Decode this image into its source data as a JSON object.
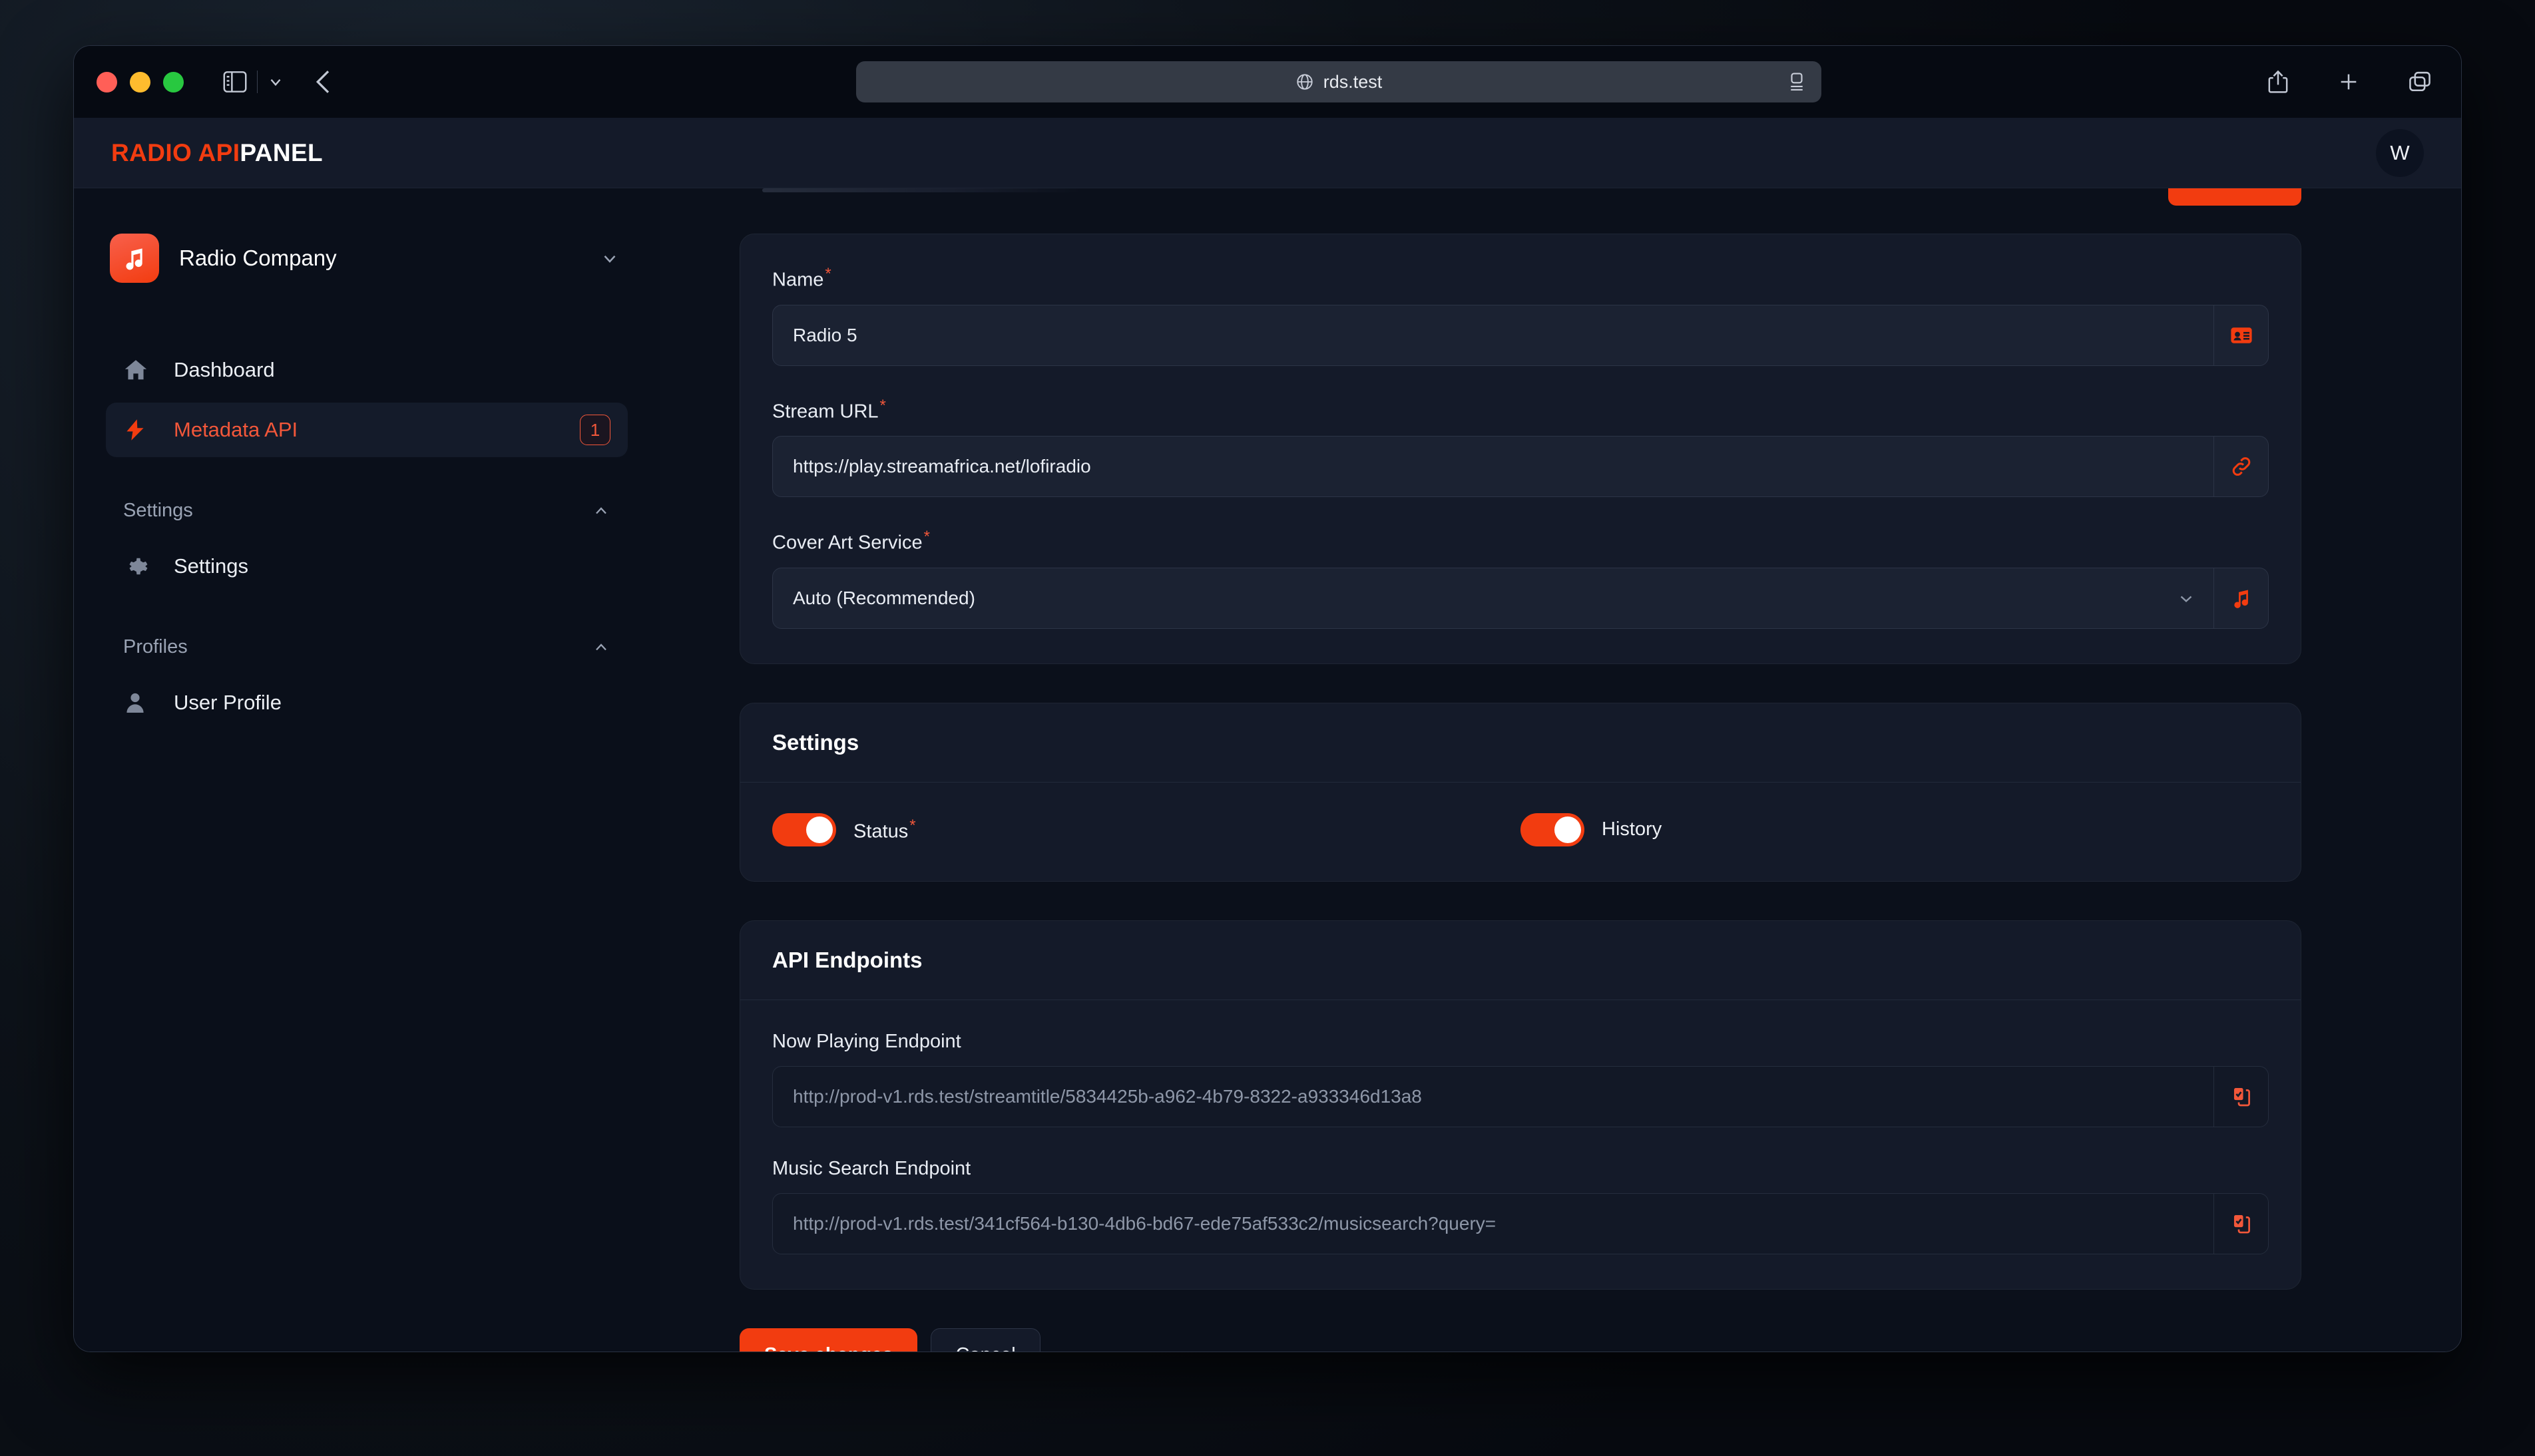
{
  "browser": {
    "url": "rds.test",
    "globe_icon": "globe-icon",
    "reader_icon": "reader-view-icon",
    "sidebar_icon": "sidebar-toggle-icon",
    "chevron_icon": "chevron-down-icon",
    "back_icon": "back-arrow-icon",
    "share_icon": "share-icon",
    "new_tab_icon": "plus-icon",
    "tabs_icon": "tab-overview-icon"
  },
  "app_header": {
    "brand_accent": "RADIO API",
    "brand_rest": "PANEL",
    "avatar_initial": "W"
  },
  "sidebar": {
    "org": {
      "name": "Radio Company",
      "logo_icon": "music-note-icon",
      "chevron_icon": "chevron-down-icon"
    },
    "items": [
      {
        "label": "Dashboard",
        "icon": "home-icon",
        "active": false,
        "badge": ""
      },
      {
        "label": "Metadata API",
        "icon": "lightning-bolt-icon",
        "active": true,
        "badge": "1"
      }
    ],
    "sections": [
      {
        "title": "Settings",
        "chevron_icon": "chevron-up-icon",
        "items": [
          {
            "label": "Settings",
            "icon": "gear-icon"
          }
        ]
      },
      {
        "title": "Profiles",
        "chevron_icon": "chevron-up-icon",
        "items": [
          {
            "label": "User Profile",
            "icon": "user-icon"
          }
        ]
      }
    ]
  },
  "main": {
    "details_card": {
      "fields": [
        {
          "label": "Name",
          "required": true,
          "value": "Radio 5",
          "addon_icon": "contact-card-icon",
          "type": "text"
        },
        {
          "label": "Stream URL",
          "required": true,
          "value": "https://play.streamafrica.net/lofiradio",
          "addon_icon": "link-icon",
          "type": "text"
        },
        {
          "label": "Cover Art Service",
          "required": true,
          "value": "Auto (Recommended)",
          "addon_icon": "music-note-icon",
          "type": "select",
          "chevron_icon": "chevron-down-icon"
        }
      ]
    },
    "settings_card": {
      "title": "Settings",
      "toggles": [
        {
          "label": "Status",
          "required": true,
          "on": true
        },
        {
          "label": "History",
          "required": false,
          "on": true
        }
      ]
    },
    "endpoints_card": {
      "title": "API Endpoints",
      "fields": [
        {
          "label": "Now Playing Endpoint",
          "value": "http://prod-v1.rds.test/streamtitle/5834425b-a962-4b79-8322-a933346d13a8",
          "addon_icon": "copy-clipboard-check-icon"
        },
        {
          "label": "Music Search Endpoint",
          "value": "http://prod-v1.rds.test/341cf564-b130-4db6-bd67-ede75af533c2/musicsearch?query=",
          "addon_icon": "copy-clipboard-check-icon"
        }
      ]
    },
    "actions": {
      "save_label": "Save changes",
      "cancel_label": "Cancel"
    }
  },
  "colors": {
    "accent": "#f23c10",
    "accent_text": "#f2573a",
    "card_bg": "#141a29",
    "page_bg": "#0b101b",
    "sidebar_bg": "#0a0f1a"
  }
}
